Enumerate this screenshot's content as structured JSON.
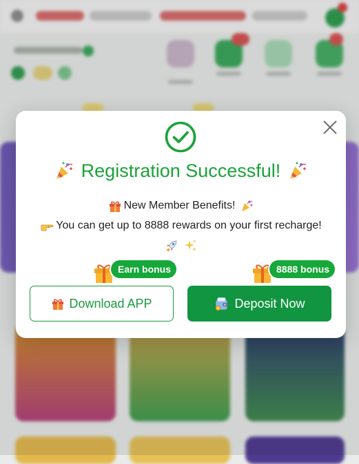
{
  "modal": {
    "title": "Registration Successful!",
    "benefit_title": "New Member Benefits!",
    "benefit_text": "You can get up to 8888 rewards on your first recharge!",
    "download_button": "Download APP",
    "deposit_button": "Deposit Now",
    "download_badge": "Earn bonus",
    "deposit_badge": "8888 bonus"
  },
  "colors": {
    "accent_green": "#1aa33a",
    "deposit_button_bg": "#119540",
    "badge_bg": "#16a83a"
  },
  "icons": [
    "check-circle-icon",
    "party-popper-icon",
    "gift-icon",
    "pointing-hand-icon",
    "rocket-icon",
    "sparkles-icon",
    "wallet-icon",
    "close-icon"
  ]
}
